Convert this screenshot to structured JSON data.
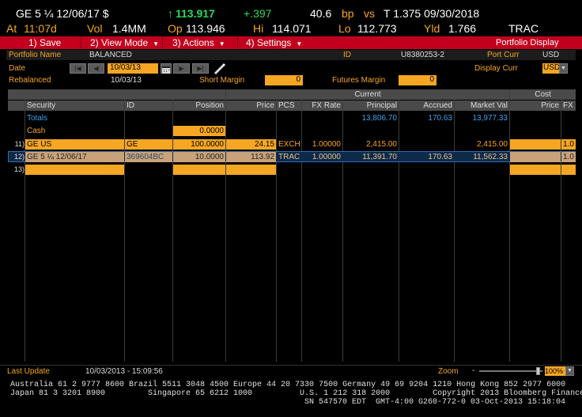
{
  "header": {
    "row1": {
      "ticker": "GE 5 ¼  12/06/17 $",
      "arrow": "↑",
      "price": "113.917",
      "change": "+.397",
      "spread": "40.6",
      "bp": "bp",
      "vs": "vs",
      "bench": "T 1.375 09/30/2018"
    },
    "row2": {
      "at_label": "At",
      "at_value": "11:07d",
      "vol_label": "Vol",
      "vol_value": "1.4MM",
      "op_label": "Op",
      "op_value": "113.946",
      "hi_label": "Hi",
      "hi_value": "114.071",
      "lo_label": "Lo",
      "lo_value": "112.773",
      "yld_label": "Yld",
      "yld_value": "1.766",
      "source": "TRAC"
    }
  },
  "toolbar": {
    "save": "1) Save",
    "view_mode": "2) View Mode",
    "actions": "3) Actions",
    "settings": "4) Settings",
    "title": "Portfolio Display",
    "colors": {
      "bar": "#c2001d",
      "accent": "#f5a623",
      "up": "#2fd85a",
      "totals": "#3ca2f0"
    }
  },
  "info": {
    "portfolio_name_label": "Portfolio Name",
    "portfolio_name_value": "BALANCED",
    "id_label": "ID",
    "id_value": "U8380253-2",
    "port_curr_label": "Port Curr",
    "port_curr_value": "USD",
    "date_label": "Date",
    "date_value": "10/03/13",
    "display_curr_label": "Display Curr",
    "display_curr_value": "USD",
    "rebalanced_label": "Rebalanced",
    "rebalanced_value": "10/03/13",
    "short_margin_label": "Short Margin",
    "short_margin_value": "0",
    "futures_margin_label": "Futures Margin",
    "futures_margin_value": "0",
    "nav_icons": [
      "first-icon",
      "prev-icon",
      "next-icon",
      "last-icon",
      "calendar-icon",
      "pen-icon"
    ]
  },
  "grid": {
    "group_current": "Current",
    "group_cost": "Cost",
    "columns": {
      "security": "Security",
      "id": "ID",
      "position": "Position",
      "price": "Price",
      "pcs": "PCS",
      "fx_rate": "FX Rate",
      "principal": "Principal",
      "accrued": "Accrued",
      "market_val": "Market Val",
      "cost_price": "Price",
      "cost_fx": "FX"
    },
    "totals": {
      "label": "Totals",
      "principal": "13,806.70",
      "accrued": "170.63",
      "market_val": "13,977.33"
    },
    "cash": {
      "label": "Cash",
      "position": "0.0000"
    },
    "rows": [
      {
        "num": "11)",
        "security": "GE US",
        "id": "GE",
        "position": "100.0000",
        "price": "24.15",
        "pcs": "EXCH",
        "fx_rate": "1.00000",
        "principal": "2,415.00",
        "accrued": "",
        "market_val": "2,415.00",
        "cost_price": "",
        "cost_fx": "1.0"
      },
      {
        "num": "12)",
        "security": "GE 5 ¼  12/06/17",
        "id": "369604BC",
        "position": "10.0000",
        "price": "113.92",
        "pcs": "TRAC",
        "fx_rate": "1.00000",
        "principal": "11,391.70",
        "accrued": "170.63",
        "market_val": "11,562.33",
        "cost_price": "",
        "cost_fx": "1.0"
      },
      {
        "num": "13)",
        "security": "",
        "id": "",
        "position": "",
        "price": "",
        "pcs": "",
        "fx_rate": "",
        "principal": "",
        "accrued": "",
        "market_val": "",
        "cost_price": "",
        "cost_fx": ""
      }
    ]
  },
  "status": {
    "last_update_label": "Last Update",
    "last_update_value": "10/03/2013 - 15:09:56",
    "zoom_label": "Zoom",
    "zoom_minus": "-",
    "zoom_value": "100%",
    "zoom_level": 1.0
  },
  "footer": {
    "line1": "Australia 61 2 9777 8600 Brazil 5511 3048 4500 Europe 44 20 7330 7500 Germany 49 69 9204 1210 Hong Kong 852 2977 6000",
    "line2": "Japan 81 3 3201 8900         Singapore 65 6212 1000          U.S. 1 212 318 2000         Copyright 2013 Bloomberg Finance L.P.",
    "line3": "SN 547570 EDT  GMT-4:00 G260-772-0 03-Oct-2013 15:18:04"
  }
}
